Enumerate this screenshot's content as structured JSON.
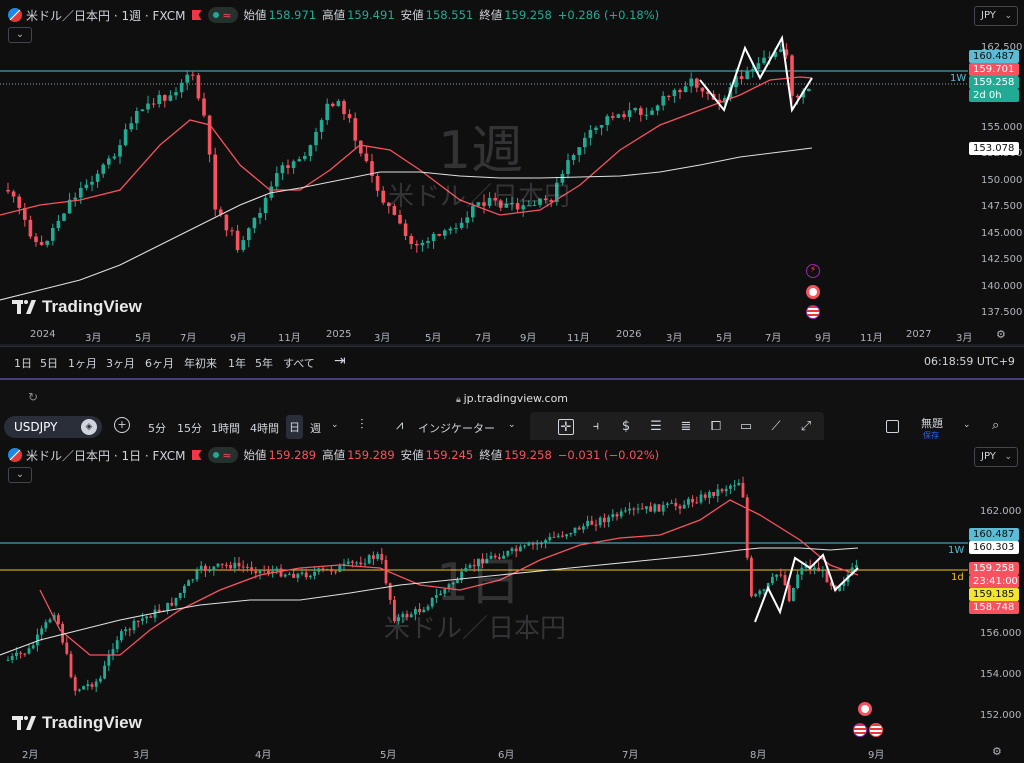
{
  "top": {
    "symbol": "米ドル／日本円 · 1週 · FXCM",
    "ohlc": {
      "open_label": "始値",
      "open": "158.971",
      "high_label": "高値",
      "high": "159.491",
      "low_label": "安値",
      "low": "158.551",
      "close_label": "終値",
      "close": "159.258",
      "change": "+0.286 (+0.18%)"
    },
    "pill_symbol": "≈",
    "collapse_icon": "chevron-down-icon",
    "currency": "JPY",
    "watermark_interval": "1週",
    "watermark_name": "米ドル／日本円",
    "logo_text": "TradingView",
    "price_ticks": [
      "162.500",
      "155.000",
      "152.500",
      "150.000",
      "147.500",
      "145.000",
      "142.500",
      "140.000",
      "137.500"
    ],
    "tags": {
      "alert": "160.487",
      "ma_fast": "159.701",
      "last": "159.258",
      "countdown": "2d 0h",
      "ma_slow": "153.078",
      "line_label": "1W"
    },
    "time_ticks": [
      "2024",
      "3月",
      "5月",
      "7月",
      "9月",
      "11月",
      "2025",
      "3月",
      "5月",
      "7月",
      "9月",
      "11月",
      "2026",
      "3月",
      "5月",
      "7月",
      "9月",
      "11月",
      "2027",
      "3月"
    ],
    "ranges": [
      "1日",
      "5日",
      "1ヶ月",
      "3ヶ月",
      "6ヶ月",
      "年初来",
      "1年",
      "5年",
      "すべて"
    ],
    "clock": "06:18:59 UTC+9",
    "colors": {
      "up": "#22ab94",
      "down": "#f7525f",
      "ma_fast": "#f7525f",
      "ma_slow": "#e0e0e0",
      "alert": "#5bbcd6"
    }
  },
  "browser": {
    "url": "jp.tradingview.com"
  },
  "toolbar": {
    "symbol": "USDJPY",
    "intervals": [
      "5分",
      "15分",
      "1時間",
      "4時間",
      "日",
      "週"
    ],
    "active_interval": "日",
    "indicators": "インジケーター",
    "layout_name": "無題",
    "layout_status": "保存"
  },
  "bottom": {
    "symbol": "米ドル／日本円 · 1日 · FXCM",
    "ohlc": {
      "open_label": "始値",
      "open": "159.289",
      "high_label": "高値",
      "high": "159.289",
      "low_label": "安値",
      "low": "159.245",
      "close_label": "終値",
      "close": "159.258",
      "change": "−0.031 (−0.02%)"
    },
    "pill_symbol": "≈",
    "collapse_icon": "chevron-down-icon",
    "currency": "JPY",
    "watermark_interval": "1日",
    "watermark_name": "米ドル／日本円",
    "logo_text": "TradingView",
    "price_ticks": [
      "162.000",
      "156.000",
      "154.000",
      "152.000"
    ],
    "tags": {
      "alert": "160.487",
      "ma_slow": "160.303",
      "last": "159.258",
      "countdown": "23:41:00",
      "yellow": "159.185",
      "ma_fast": "158.748",
      "line_label_w": "1W",
      "line_label_d": "1d"
    },
    "time_ticks": [
      "2月",
      "3月",
      "4月",
      "5月",
      "6月",
      "7月",
      "8月",
      "9月"
    ]
  }
}
